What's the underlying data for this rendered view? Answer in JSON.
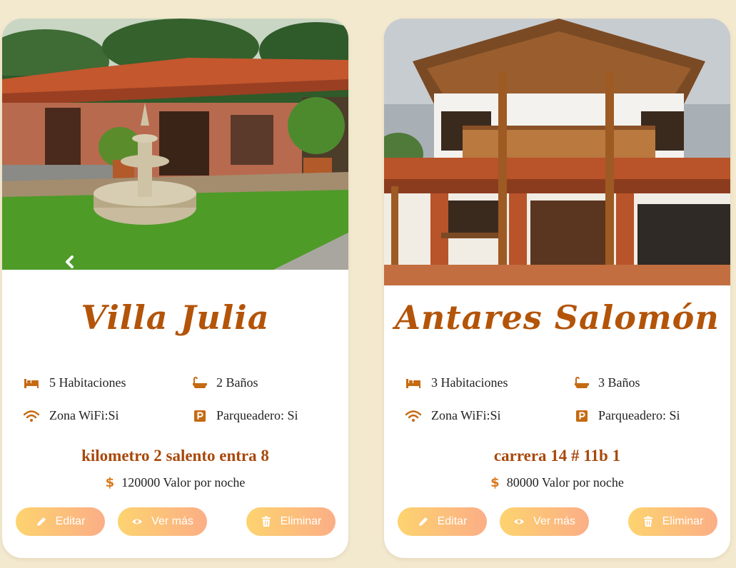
{
  "cards": [
    {
      "name": "Villa Julia",
      "rooms": "5 Habitaciones",
      "baths": "2 Baños",
      "wifi": "Zona WiFi:Si",
      "parking": "Parqueadero: Si",
      "address": "kilometro 2 salento entra 8",
      "price": "120000 Valor por noche",
      "edit_label": "Editar",
      "view_label": "Ver más",
      "delete_label": "Eliminar"
    },
    {
      "name": "Antares Salomón",
      "rooms": "3 Habitaciones",
      "baths": "3 Baños",
      "wifi": "Zona WiFi:Si",
      "parking": "Parqueadero: Si",
      "address": "carrera 14 # 11b 1",
      "price": "80000 Valor por noche",
      "edit_label": "Editar",
      "view_label": "Ver más",
      "delete_label": "Eliminar"
    }
  ],
  "icons": {
    "rooms": "bed-icon",
    "baths": "bathtub-icon",
    "wifi": "wifi-icon",
    "parking": "parking-icon",
    "price": "dollar-icon",
    "edit": "pencil-icon",
    "view": "eye-icon",
    "delete": "trash-icon",
    "carousel_prev": "chevron-left-icon"
  },
  "colors": {
    "accent": "#b35409",
    "button_gradient_start": "#fdd36f",
    "button_gradient_end": "#fbae86",
    "background": "#f3e9cf"
  }
}
